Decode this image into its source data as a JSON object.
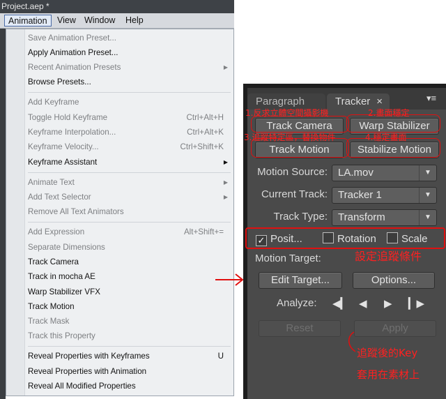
{
  "window": {
    "title": "Project.aep *"
  },
  "menubar": {
    "items": [
      "Animation",
      "View",
      "Window",
      "Help"
    ]
  },
  "menu": {
    "items": [
      {
        "label": "Save Animation Preset...",
        "enabled": false
      },
      {
        "label": "Apply Animation Preset...",
        "enabled": true
      },
      {
        "label": "Recent Animation Presets",
        "enabled": false,
        "submenu": true
      },
      {
        "label": "Browse Presets...",
        "enabled": true
      },
      {
        "label": "Add Keyframe",
        "enabled": false
      },
      {
        "label": "Toggle Hold Keyframe",
        "enabled": false,
        "shortcut": "Ctrl+Alt+H"
      },
      {
        "label": "Keyframe Interpolation...",
        "enabled": false,
        "shortcut": "Ctrl+Alt+K"
      },
      {
        "label": "Keyframe Velocity...",
        "enabled": false,
        "shortcut": "Ctrl+Shift+K"
      },
      {
        "label": "Keyframe Assistant",
        "enabled": true,
        "submenu": true
      },
      {
        "label": "Animate Text",
        "enabled": false,
        "submenu": true
      },
      {
        "label": "Add Text Selector",
        "enabled": false,
        "submenu": true
      },
      {
        "label": "Remove All Text Animators",
        "enabled": false
      },
      {
        "label": "Add Expression",
        "enabled": false,
        "shortcut": "Alt+Shift+="
      },
      {
        "label": "Separate Dimensions",
        "enabled": false
      },
      {
        "label": "Track Camera",
        "enabled": true
      },
      {
        "label": "Track in mocha AE",
        "enabled": true
      },
      {
        "label": "Warp Stabilizer VFX",
        "enabled": true
      },
      {
        "label": "Track Motion",
        "enabled": true,
        "highlighted": true
      },
      {
        "label": "Track Mask",
        "enabled": false
      },
      {
        "label": "Track this Property",
        "enabled": false
      },
      {
        "label": "Reveal Properties with Keyframes",
        "enabled": true,
        "shortcut": "U"
      },
      {
        "label": "Reveal Properties with Animation",
        "enabled": true
      },
      {
        "label": "Reveal All Modified Properties",
        "enabled": true
      }
    ]
  },
  "tracker": {
    "tabs": {
      "paragraph": "Paragraph",
      "tracker": "Tracker",
      "close": "×",
      "panel_menu": "▾≡"
    },
    "buttons": {
      "track_camera": "Track Camera",
      "warp_stabilizer": "Warp Stabilizer",
      "track_motion": "Track Motion",
      "stabilize_motion": "Stabilize Motion",
      "edit_target": "Edit Target...",
      "options": "Options...",
      "reset": "Reset",
      "apply": "Apply"
    },
    "fields": {
      "motion_source_label": "Motion Source:",
      "motion_source_value": "LA.mov",
      "current_track_label": "Current Track:",
      "current_track_value": "Tracker 1",
      "track_type_label": "Track Type:",
      "track_type_value": "Transform",
      "motion_target_label": "Motion Target:",
      "analyze_label": "Analyze:"
    },
    "checkboxes": {
      "position": {
        "label": "Posit...",
        "checked": true
      },
      "rotation": {
        "label": "Rotation",
        "checked": false
      },
      "scale": {
        "label": "Scale",
        "checked": false
      }
    }
  },
  "annotations": {
    "n1": "1.反求立體空間攝影機",
    "n2": "2.畫面穩定",
    "n3": "3.追蹤特定區，替換物件",
    "n4": "4.穩定畫面",
    "n5": "設定追蹤條件",
    "n6": "追蹤後的Key",
    "n7": "套用在素材上"
  },
  "colors": {
    "annotation": "#ff2020",
    "panel_bg": "#4a4a4a",
    "menu_highlight": "#dde7f3"
  }
}
